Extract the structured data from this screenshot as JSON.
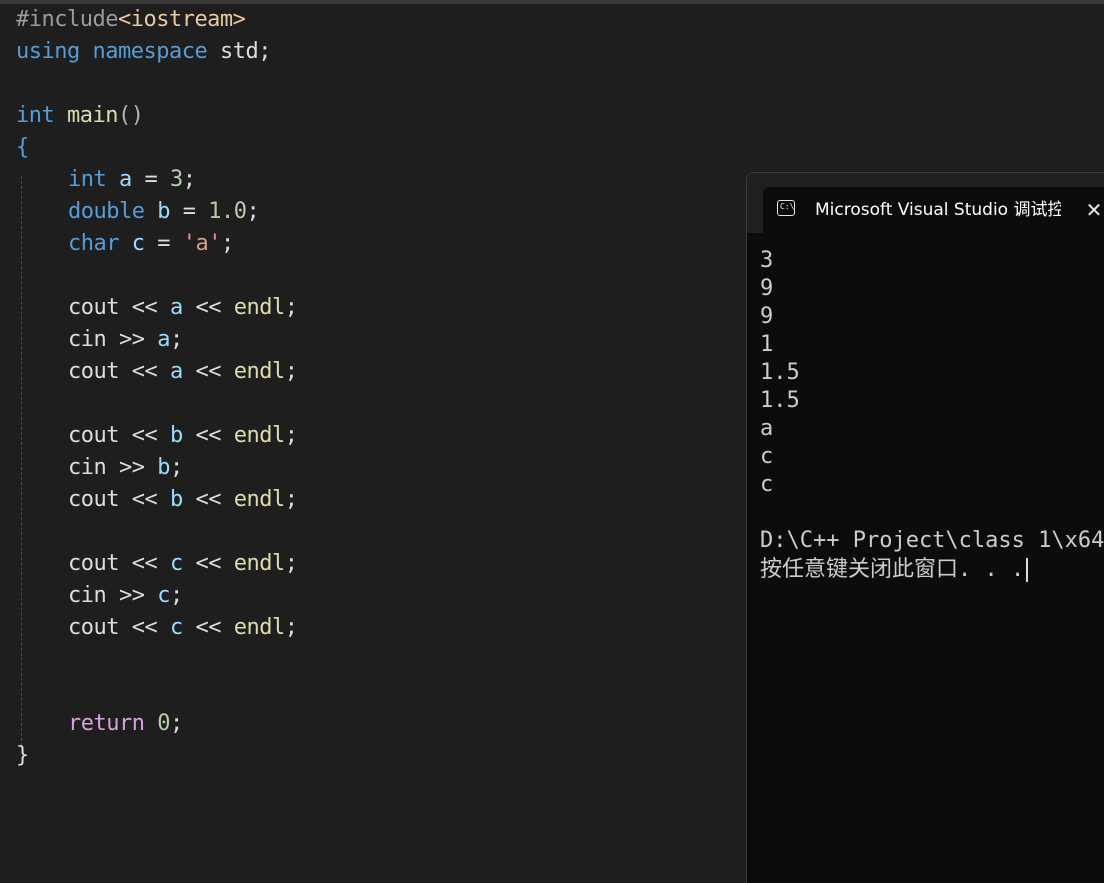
{
  "code": {
    "include_directive": "#include",
    "include_header": "<iostream>",
    "using_kw": "using",
    "namespace_kw": "namespace",
    "namespace_name": "std",
    "semicolon": ";",
    "int_kw": "int",
    "double_kw": "double",
    "char_kw": "char",
    "main_name": "main",
    "parens": "()",
    "open_brace": "{",
    "close_brace": "}",
    "var_a": "a",
    "var_b": "b",
    "var_c": "c",
    "assign": " = ",
    "val_a": "3",
    "val_b": "1.0",
    "val_c": "'a'",
    "cout": "cout",
    "cin": "cin",
    "shl": " << ",
    "shr": " >> ",
    "endl": "endl",
    "return_kw": "return",
    "return_val": "0"
  },
  "console": {
    "title": "Microsoft Visual Studio 调试控制台",
    "icon": "command-prompt-icon",
    "icon_text": "C:\\",
    "close_glyph": "✕",
    "output_lines": [
      "3",
      "9",
      "9",
      "1",
      "1.5",
      "1.5",
      "a",
      "c",
      "c"
    ],
    "path_line": "D:\\C++ Project\\class 1\\x64",
    "press_key_line": "按任意键关闭此窗口. . ."
  }
}
